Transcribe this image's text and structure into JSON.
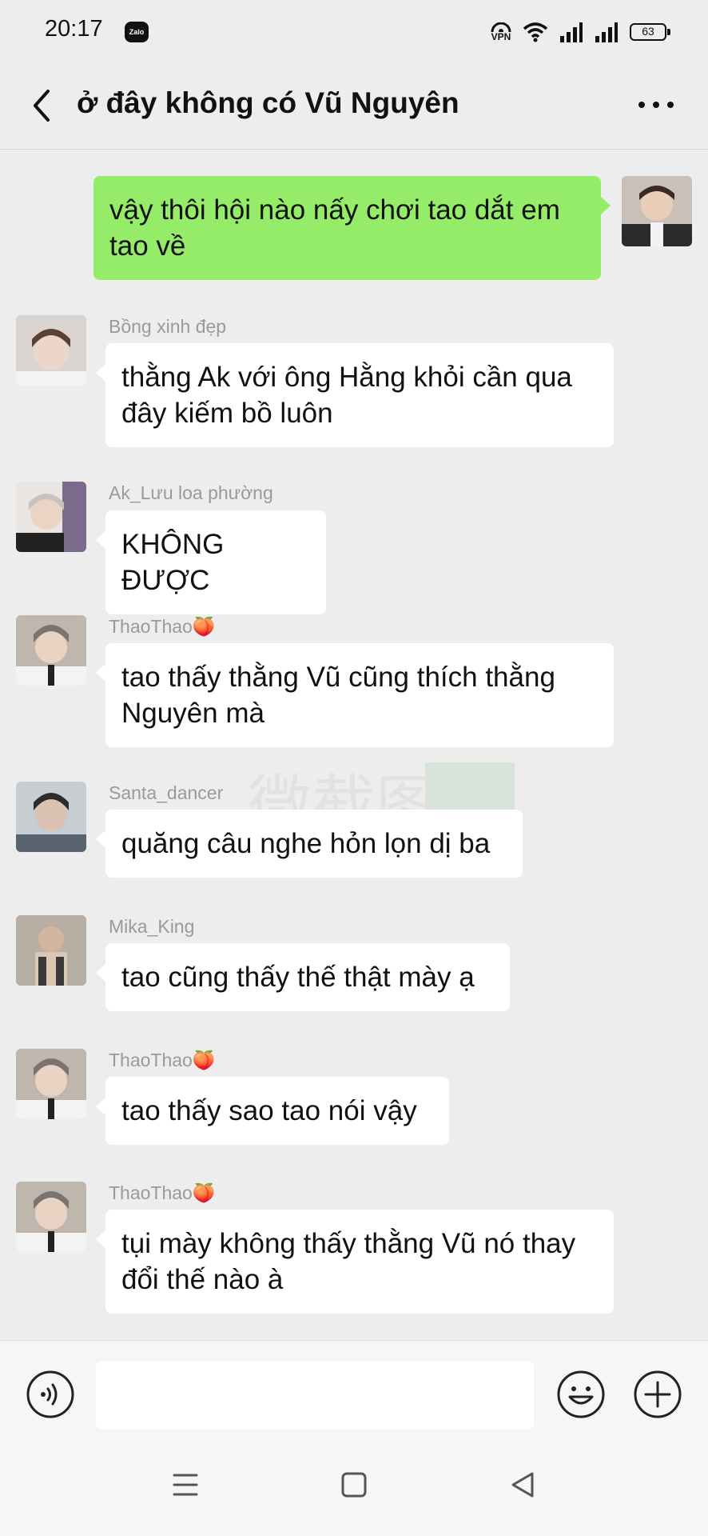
{
  "status_bar": {
    "time": "20:17",
    "app_badge": "Zalo",
    "vpn_label": "VPN",
    "battery": "63"
  },
  "header": {
    "title": "ở đây không có Vũ Nguyên"
  },
  "messages": [
    {
      "sender": "",
      "text": "vậy thôi hội nào nấy chơi tao dắt em tao về",
      "mine": true
    },
    {
      "sender": "Bồng xinh đẹp",
      "text": "thằng Ak với ông Hằng khỏi cần qua đây kiếm bồ luôn",
      "mine": false
    },
    {
      "sender": "Ak_Lưu loa phường",
      "text": "KHÔNG ĐƯỢC",
      "mine": false
    },
    {
      "sender": "ThaoThao🍑",
      "text": "tao thấy thằng Vũ cũng thích thằng Nguyên mà",
      "mine": false
    },
    {
      "sender": "Santa_dancer",
      "text": "quăng câu nghe hỏn lọn dị ba",
      "mine": false
    },
    {
      "sender": "Mika_King",
      "text": "tao cũng thấy thế thật mày ạ",
      "mine": false
    },
    {
      "sender": "ThaoThao🍑",
      "text": "tao thấy sao tao nói vậy",
      "mine": false
    },
    {
      "sender": "ThaoThao🍑",
      "text": "tụi mày không thấy thằng Vũ nó thay đổi thế nào à",
      "mine": false
    }
  ],
  "input": {
    "value": "",
    "placeholder": ""
  },
  "watermark": "微截图",
  "colors": {
    "background": "#ededed",
    "my_bubble": "#95ec69",
    "other_bubble": "#ffffff",
    "sender_name": "#9a9a9a"
  }
}
